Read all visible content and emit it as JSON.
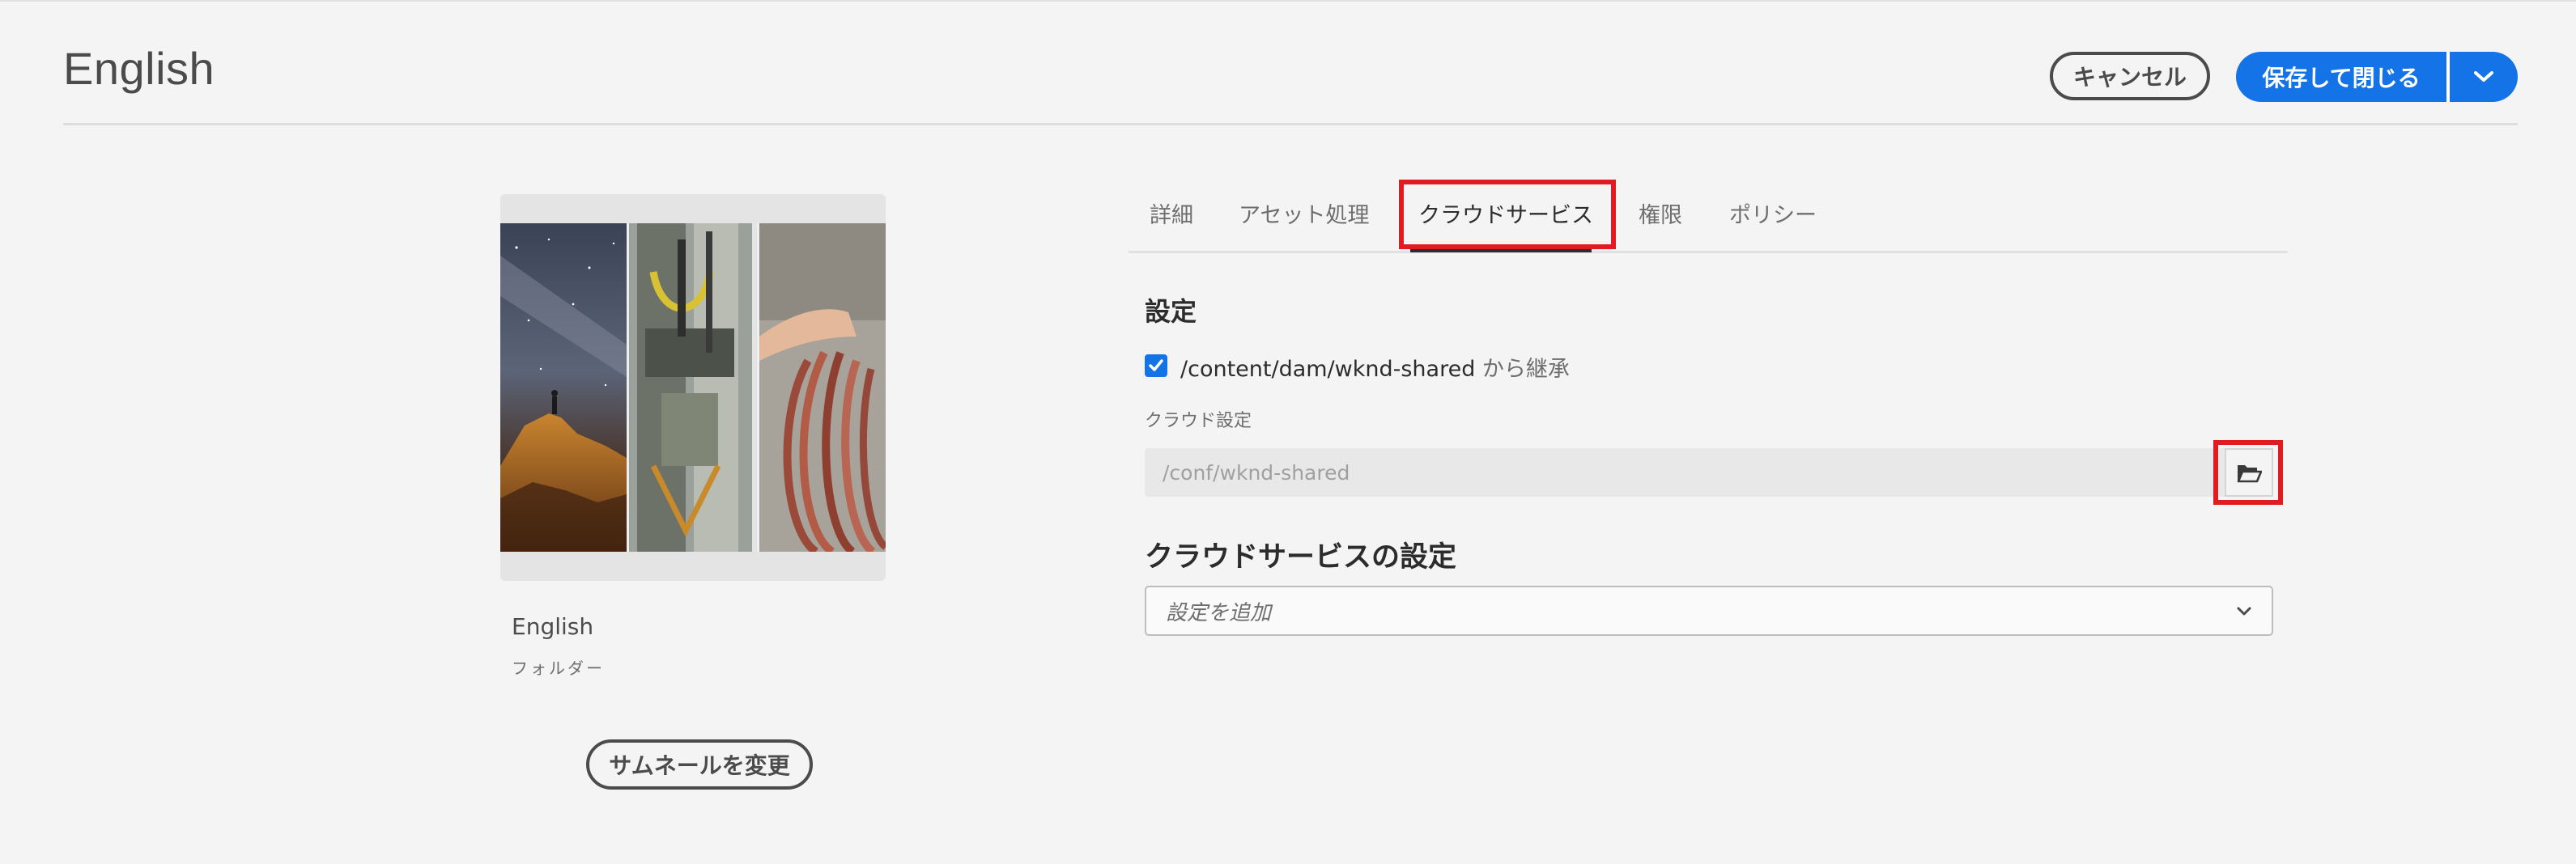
{
  "header": {
    "title": "English",
    "cancel_label": "キャンセル",
    "save_close_label": "保存して閉じる",
    "accent_color": "#1473e6"
  },
  "asset": {
    "name": "English",
    "type": "フォルダー",
    "change_thumbnail_label": "サムネールを変更"
  },
  "tabs": [
    {
      "label": "詳細",
      "active": false
    },
    {
      "label": "アセット処理",
      "active": false
    },
    {
      "label": "クラウドサービス",
      "active": true
    },
    {
      "label": "権限",
      "active": false
    },
    {
      "label": "ポリシー",
      "active": false
    }
  ],
  "settings": {
    "title": "設定",
    "inherit_checked": true,
    "inherit_path": "/content/dam/wknd-shared",
    "inherit_suffix": " から継承",
    "cloud_config_label": "クラウド設定",
    "cloud_config_value": "/conf/wknd-shared",
    "browse_icon": "folder-open-icon"
  },
  "cloud_services": {
    "title": "クラウドサービスの設定",
    "add_placeholder": "設定を追加"
  },
  "highlight_color": "#e11b22"
}
